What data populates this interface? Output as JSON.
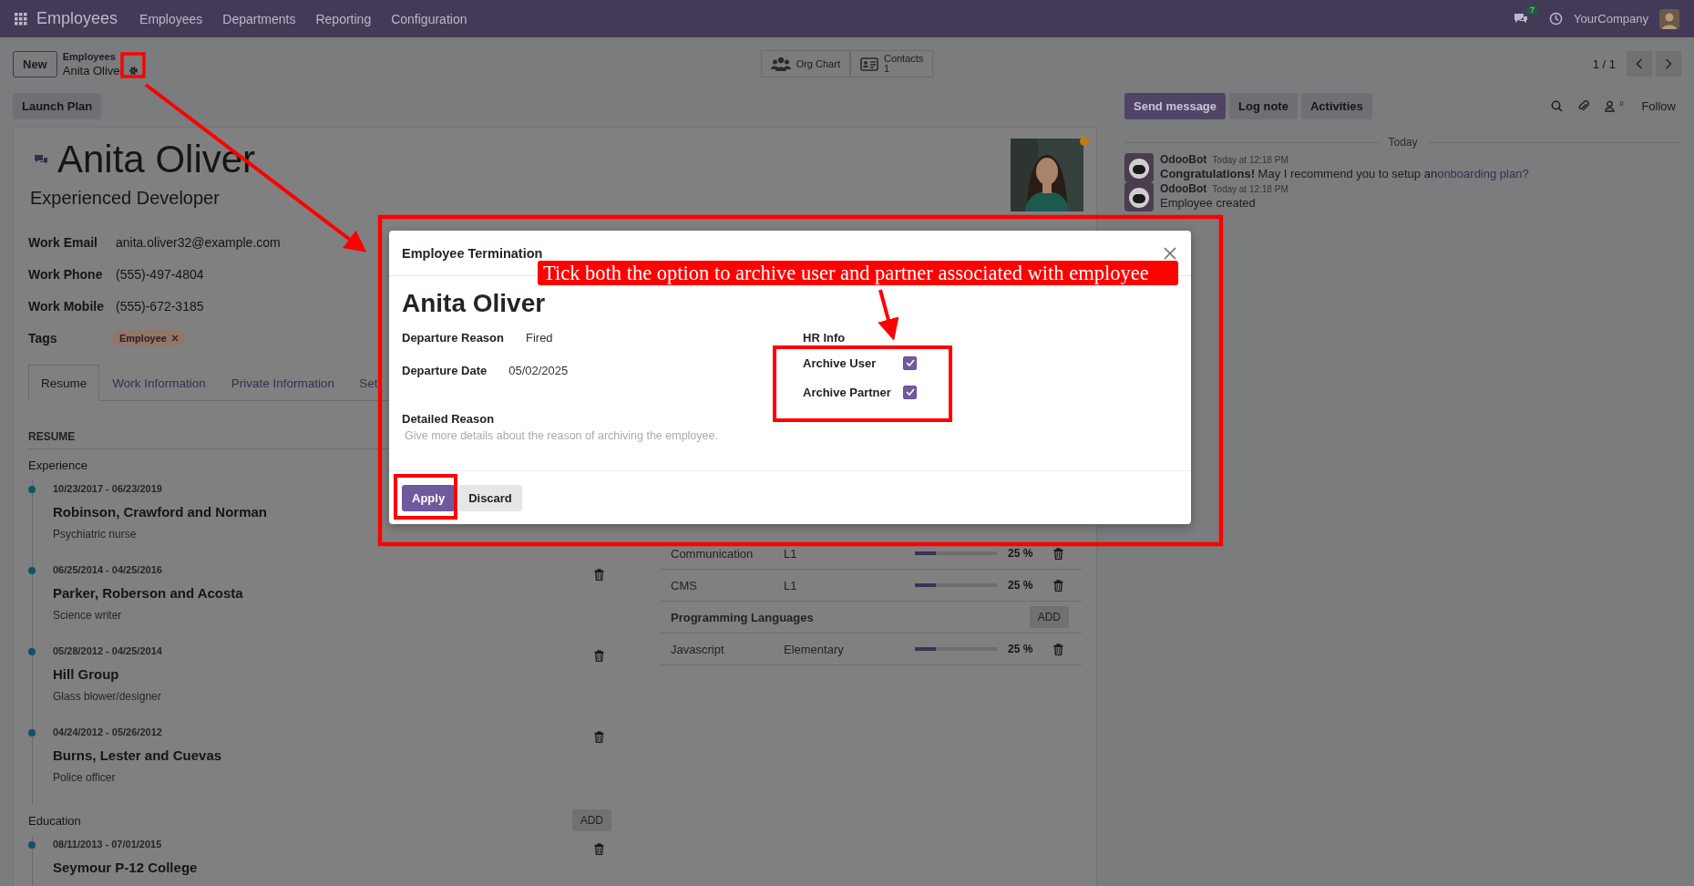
{
  "navbar": {
    "app": "Employees",
    "menus": [
      "Employees",
      "Departments",
      "Reporting",
      "Configuration"
    ],
    "chat_count": "7",
    "company": "YourCompany"
  },
  "control_panel": {
    "new_button": "New",
    "breadcrumb": "Employees",
    "record": "Anita Oliver",
    "views": [
      {
        "label": "Org Chart",
        "kind": "org"
      },
      {
        "label": "Contacts",
        "count": "1",
        "kind": "contacts"
      }
    ],
    "pager": "1 / 1"
  },
  "action_bar": {
    "buttons": [
      "Launch Plan"
    ]
  },
  "employee": {
    "name": "Anita Oliver",
    "job_title": "Experienced Developer",
    "fields": [
      {
        "label": "Work Email",
        "value": "anita.oliver32@example.com"
      },
      {
        "label": "Work Phone",
        "value": "(555)-497-4804"
      },
      {
        "label": "Work Mobile",
        "value": "(555)-672-3185"
      }
    ],
    "tags_label": "Tags",
    "tags": [
      "Employee"
    ]
  },
  "tabs": [
    {
      "label": "Resume",
      "selected": true
    },
    {
      "label": "Work Information",
      "selected": false
    },
    {
      "label": "Private Information",
      "selected": false
    },
    {
      "label": "Set",
      "selected": false
    }
  ],
  "resume": {
    "title": "RESUME",
    "sections": [
      {
        "title": "Experience",
        "entries": [
          {
            "dates": "10/23/2017 - 06/23/2019",
            "title": "Robinson, Crawford and Norman",
            "subtitle": "Psychiatric nurse",
            "deletable": false
          },
          {
            "dates": "06/25/2014 - 04/25/2016",
            "title": "Parker, Roberson and Acosta",
            "subtitle": "Science writer",
            "deletable": true
          },
          {
            "dates": "05/28/2012 - 04/25/2014",
            "title": "Hill Group",
            "subtitle": "Glass blower/designer",
            "deletable": true
          },
          {
            "dates": "04/24/2012 - 05/26/2012",
            "title": "Burns, Lester and Cuevas",
            "subtitle": "Police officer",
            "deletable": true
          }
        ]
      },
      {
        "title": "Education",
        "add": "ADD",
        "entries": [
          {
            "dates": "08/11/2013 - 07/01/2015",
            "title": "Seymour P-12 College",
            "deletable": true
          }
        ]
      }
    ]
  },
  "skills": {
    "rows": [
      {
        "kind": "skill",
        "name": "Communication",
        "level_name": "L1",
        "level": 0.25,
        "percent": "25 %"
      },
      {
        "kind": "skill",
        "name": "CMS",
        "level_name": "L1",
        "level": 0.25,
        "percent": "25 %"
      },
      {
        "kind": "group",
        "name": "Programming Languages",
        "add": "ADD"
      },
      {
        "kind": "skill",
        "name": "Javascript",
        "level_name": "Elementary",
        "level": 0.25,
        "percent": "25 %"
      }
    ]
  },
  "chatter": {
    "buttons": [
      {
        "label": "Send message",
        "selected": true
      },
      {
        "label": "Log note",
        "selected": false
      },
      {
        "label": "Activities",
        "selected": false
      }
    ],
    "follower_count": "0",
    "follow": "Follow",
    "divider": "Today",
    "messages": [
      {
        "author": "OdooBot",
        "time": "Today at 12:18 PM",
        "body": "**Congratulations!** May I recommend you to setup an",
        "link": "onboarding plan?"
      },
      {
        "author": "OdooBot",
        "time": "Today at 12:18 PM",
        "body": "Employee created"
      }
    ]
  },
  "dialog": {
    "title": "Employee Termination",
    "name": "Anita Oliver",
    "fields": [
      {
        "label": "Departure Reason",
        "value": "Fired"
      },
      {
        "label": "Departure Date",
        "value": "05/02/2025"
      }
    ],
    "hr_info": {
      "title": "HR Info",
      "options": [
        {
          "label": "Archive User",
          "checked": true
        },
        {
          "label": "Archive Partner",
          "checked": true
        }
      ]
    },
    "detailed_reason": {
      "label": "Detailed Reason",
      "placeholder": "Give more details about the reason of archiving the employee."
    },
    "buttons": [
      {
        "label": "Apply",
        "kind": "primary"
      },
      {
        "label": "Discard",
        "kind": "secondary"
      }
    ]
  },
  "annotation": {
    "callout": "Tick both the option to archive user and partner associated with employee"
  }
}
